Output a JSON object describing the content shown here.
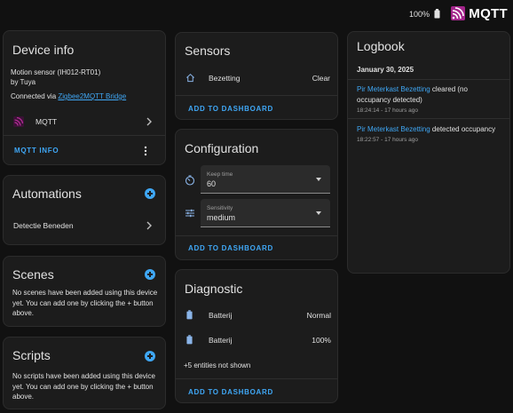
{
  "topbar": {
    "battery_text": "100%",
    "logo_text": "MQTT",
    "logo_color": "#a3258b"
  },
  "device_info": {
    "title": "Device info",
    "model": "Motion sensor (IH012-RT01)",
    "manufacturer": "by Tuya",
    "connected_prefix": "Connected via ",
    "connected_link": "Zigbee2MQTT Bridge",
    "integration_label": "MQTT",
    "mqtt_info_label": "MQTT INFO"
  },
  "automations": {
    "title": "Automations",
    "items": [
      {
        "label": "Detectie Beneden"
      }
    ]
  },
  "scenes": {
    "title": "Scenes",
    "description": "No scenes have been added using this device yet. You can add one by clicking the + button above."
  },
  "scripts": {
    "title": "Scripts",
    "description": "No scripts have been added using this device yet. You can add one by clicking the + button above."
  },
  "sensors": {
    "title": "Sensors",
    "items": [
      {
        "icon": "home-outline-icon",
        "label": "Bezetting",
        "value": "Clear"
      }
    ],
    "add_label": "ADD TO DASHBOARD"
  },
  "configuration": {
    "title": "Configuration",
    "keep_time": {
      "icon": "timer-icon",
      "label": "Keep time",
      "value": "60"
    },
    "sensitivity": {
      "icon": "tune-icon",
      "label": "Sensitivity",
      "value": "medium"
    },
    "add_label": "ADD TO DASHBOARD"
  },
  "diagnostic": {
    "title": "Diagnostic",
    "items": [
      {
        "icon": "battery-icon",
        "label": "Batterij",
        "value": "Normal"
      },
      {
        "icon": "battery-icon",
        "label": "Batterij",
        "value": "100%"
      }
    ],
    "more_entities": "+5 entities not shown",
    "add_label": "ADD TO DASHBOARD"
  },
  "logbook": {
    "title": "Logbook",
    "date": "January 30, 2025",
    "entries": [
      {
        "entity": "Pir Meterkast Bezetting",
        "message": " cleared (no occupancy detected)",
        "time": "18:24:14 - 17 hours ago"
      },
      {
        "entity": "Pir Meterkast Bezetting",
        "message": " detected occupancy",
        "time": "18:22:57 - 17 hours ago"
      }
    ]
  },
  "colors": {
    "accent": "#3fa7f5",
    "background": "#111111",
    "card": "#1c1c1c"
  }
}
